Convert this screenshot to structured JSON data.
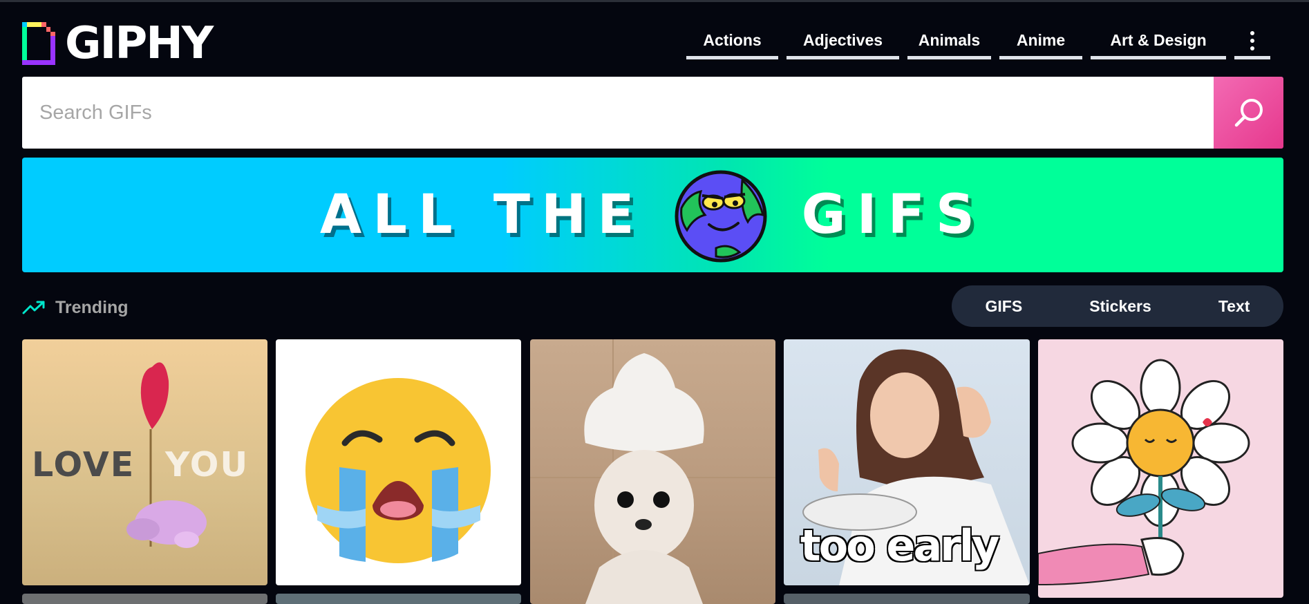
{
  "app": {
    "brand_name": "GIPHY",
    "accent_color": "#e6388d"
  },
  "nav": {
    "items": [
      {
        "label": "Actions"
      },
      {
        "label": "Adjectives"
      },
      {
        "label": "Animals"
      },
      {
        "label": "Anime"
      },
      {
        "label": "Art & Design"
      }
    ],
    "more_icon": "more-vertical-icon"
  },
  "search": {
    "placeholder": "Search GIFs",
    "value": "",
    "button_icon": "search-icon"
  },
  "banner": {
    "text_left": "ALL THE",
    "text_right": "GIFS"
  },
  "trending": {
    "label": "Trending",
    "icon": "trending-up-icon"
  },
  "content_tabs": [
    {
      "label": "GIFS"
    },
    {
      "label": "Stickers"
    },
    {
      "label": "Text"
    }
  ],
  "grid": {
    "gifs": [
      {
        "caption_left": "LOVE",
        "caption_right": "YOU",
        "subject": "balloon-elephant"
      },
      {
        "subject": "crying-emoji"
      },
      {
        "subject": "chihuahua-foam-hat"
      },
      {
        "caption": "too early",
        "subject": "tired-woman"
      },
      {
        "subject": "flower-sticker"
      }
    ]
  }
}
